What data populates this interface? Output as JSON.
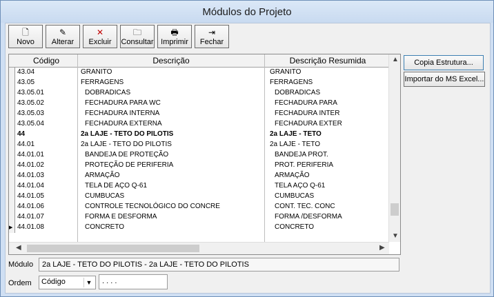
{
  "window": {
    "title": "Módulos do Projeto"
  },
  "toolbar": {
    "buttons": [
      {
        "label": "Novo",
        "icon": "new-doc-icon",
        "glyph": "🗋"
      },
      {
        "label": "Alterar",
        "icon": "edit-pencil-icon",
        "glyph": "✎"
      },
      {
        "label": "Excluir",
        "icon": "delete-x-icon",
        "glyph": "✕"
      },
      {
        "label": "Consultar",
        "icon": "open-folder-icon",
        "glyph": "🗀"
      },
      {
        "label": "Imprimir",
        "icon": "printer-icon",
        "glyph": "🖶"
      },
      {
        "label": "Fechar",
        "icon": "exit-door-icon",
        "glyph": "⇥"
      }
    ]
  },
  "grid": {
    "headers": [
      "Código",
      "Descrição",
      "Descrição Resumida"
    ],
    "rows": [
      {
        "code": "43.04",
        "desc": "GRANITO",
        "short": "GRANITO",
        "bold": false,
        "indent": 0
      },
      {
        "code": "43.05",
        "desc": "FERRAGENS",
        "short": "FERRAGENS",
        "bold": false,
        "indent": 0
      },
      {
        "code": "43.05.01",
        "desc": "DOBRADICAS",
        "short": "DOBRADICAS",
        "bold": false,
        "indent": 1
      },
      {
        "code": "43.05.02",
        "desc": "FECHADURA PARA WC",
        "short": "FECHADURA PARA",
        "bold": false,
        "indent": 1
      },
      {
        "code": "43.05.03",
        "desc": "FECHADURA INTERNA",
        "short": "FECHADURA INTER",
        "bold": false,
        "indent": 1
      },
      {
        "code": "43.05.04",
        "desc": "FECHADURA EXTERNA",
        "short": "FECHADURA EXTER",
        "bold": false,
        "indent": 1
      },
      {
        "code": "44",
        "desc": "2a LAJE - TETO DO PILOTIS",
        "short": "2a LAJE - TETO",
        "bold": true,
        "indent": 0
      },
      {
        "code": "44.01",
        "desc": "2a LAJE - TETO DO PILOTIS",
        "short": "2a LAJE - TETO",
        "bold": false,
        "indent": 0
      },
      {
        "code": "44.01.01",
        "desc": "BANDEJA DE PROTEÇÃO",
        "short": "BANDEJA PROT.",
        "bold": false,
        "indent": 1
      },
      {
        "code": "44.01.02",
        "desc": "PROTEÇÃO DE PERIFERIA",
        "short": "PROT. PERIFERIA",
        "bold": false,
        "indent": 1
      },
      {
        "code": "44.01.03",
        "desc": "ARMAÇÃO",
        "short": "ARMAÇÃO",
        "bold": false,
        "indent": 1
      },
      {
        "code": "44.01.04",
        "desc": "TELA DE AÇO Q-61",
        "short": "TELA AÇO Q-61",
        "bold": false,
        "indent": 1
      },
      {
        "code": "44.01.05",
        "desc": "CUMBUCAS",
        "short": "CUMBUCAS",
        "bold": false,
        "indent": 1
      },
      {
        "code": "44.01.06",
        "desc": "CONTROLE TECNOLÓGICO DO CONCRE",
        "short": "CONT. TEC. CONC",
        "bold": false,
        "indent": 1
      },
      {
        "code": "44.01.07",
        "desc": "FORMA E DESFORMA",
        "short": "FORMA /DESFORMA",
        "bold": false,
        "indent": 1
      },
      {
        "code": "44.01.08",
        "desc": "CONCRETO",
        "short": "CONCRETO",
        "bold": false,
        "indent": 1,
        "current": true
      }
    ]
  },
  "side": {
    "copy_label": "Copia Estrutura...",
    "import_label": "Importar do MS Excel..."
  },
  "footer": {
    "modulo_label": "Módulo",
    "modulo_value": "2a LAJE - TETO DO PILOTIS - 2a LAJE - TETO DO PILOTIS",
    "ordem_label": "Ordem",
    "ordem_value": "Código",
    "search_value": ". . . ."
  }
}
